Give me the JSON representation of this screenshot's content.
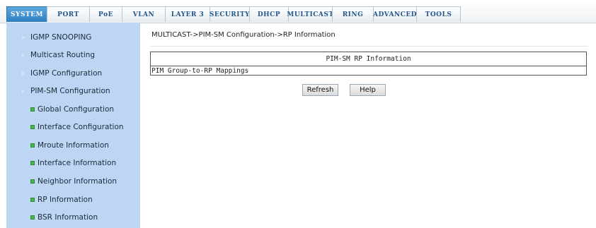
{
  "tabs": [
    {
      "label": "SYSTEM",
      "active": true
    },
    {
      "label": "PORT",
      "active": false
    },
    {
      "label": "PoE",
      "active": false
    },
    {
      "label": "VLAN",
      "active": false
    },
    {
      "label": "LAYER 3",
      "active": false
    },
    {
      "label": "SECURITY",
      "active": false
    },
    {
      "label": "DHCP",
      "active": false
    },
    {
      "label": "MULTICAST",
      "active": false
    },
    {
      "label": "RING",
      "active": false
    },
    {
      "label": "ADVANCED",
      "active": false
    },
    {
      "label": "TOOLS",
      "active": false
    }
  ],
  "sidebar": {
    "items": [
      {
        "label": "IGMP SNOOPING",
        "level": "top"
      },
      {
        "label": "Multicast Routing",
        "level": "top"
      },
      {
        "label": "IGMP Configuration",
        "level": "top"
      },
      {
        "label": "PIM-SM Configuration",
        "level": "top"
      },
      {
        "label": "Global Configuration",
        "level": "sub"
      },
      {
        "label": "Interface Configuration",
        "level": "sub"
      },
      {
        "label": "Mroute Information",
        "level": "sub"
      },
      {
        "label": "Interface Information",
        "level": "sub"
      },
      {
        "label": "Neighbor Information",
        "level": "sub"
      },
      {
        "label": "RP Information",
        "level": "sub"
      },
      {
        "label": "BSR Information",
        "level": "sub"
      }
    ]
  },
  "main": {
    "breadcrumb": "MULTICAST->PIM-SM Configuration->RP Information",
    "table_title": "PIM-SM RP Information",
    "table_row": "PIM Group-to-RP Mappings",
    "refresh_label": "Refresh",
    "help_label": "Help"
  },
  "colors": {
    "active_tab": "#2e7fc1",
    "sidebar_bg": "#bcd6f4",
    "sub_marker": "#49b649"
  }
}
